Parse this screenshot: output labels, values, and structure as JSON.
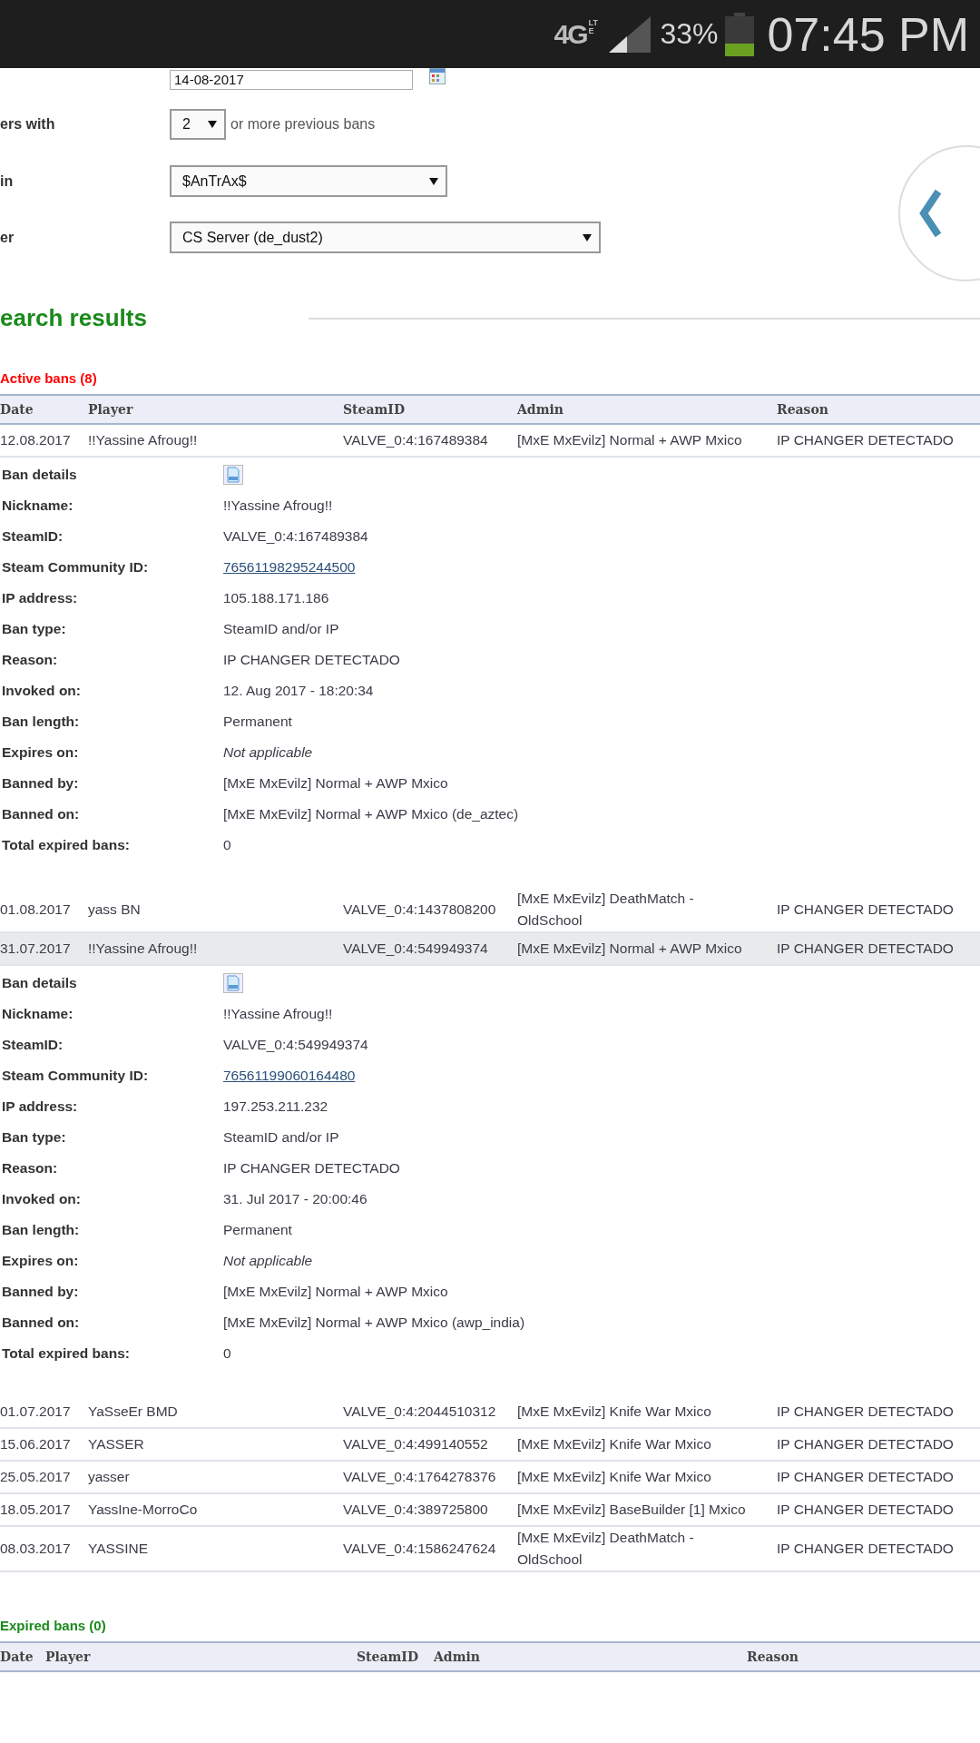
{
  "status_bar": {
    "network": "4G",
    "network_sub": "LTE",
    "battery": "33%",
    "time": "07:45 PM"
  },
  "filters": [
    {
      "kind": "date",
      "value": "14-08-2017"
    },
    {
      "kind": "count",
      "label": "ers with",
      "value": "2",
      "suffix": "or more previous bans"
    },
    {
      "kind": "select",
      "label": "in",
      "value": "$AnTrAx$"
    },
    {
      "kind": "wide-select",
      "label": "er",
      "value": "CS Server (de_dust2)"
    }
  ],
  "heading": "earch results",
  "active_bans": {
    "title": "Active bans (8)",
    "columns": [
      "Date",
      "Player",
      "SteamID",
      "Admin",
      "Reason"
    ],
    "rows": [
      {
        "date": "12.08.2017",
        "player": "!!Yassine Afroug!!",
        "steamid": "VALVE_0:4:167489384",
        "admin": "[MxE MxEvilz] Normal + AWP Mxico",
        "reason": "IP CHANGER DETECTADO",
        "selected": false,
        "details": [
          {
            "kind": "header",
            "label": "Ban details"
          },
          {
            "kind": "text",
            "label": "Nickname:",
            "value": "!!Yassine Afroug!!"
          },
          {
            "kind": "text",
            "label": "SteamID:",
            "value": "VALVE_0:4:167489384"
          },
          {
            "kind": "link",
            "label": "Steam Community ID:",
            "value": "76561198295244500"
          },
          {
            "kind": "text",
            "label": "IP address:",
            "value": "105.188.171.186"
          },
          {
            "kind": "text",
            "label": "Ban type:",
            "value": "SteamID and/or IP"
          },
          {
            "kind": "text",
            "label": "Reason:",
            "value": "IP CHANGER DETECTADO"
          },
          {
            "kind": "text",
            "label": "Invoked on:",
            "value": "12. Aug 2017 - 18:20:34"
          },
          {
            "kind": "text",
            "label": "Ban length:",
            "value": "Permanent"
          },
          {
            "kind": "note",
            "label": "Expires on:",
            "value": "Not applicable"
          },
          {
            "kind": "text",
            "label": "Banned by:",
            "value": "[MxE MxEvilz] Normal + AWP Mxico"
          },
          {
            "kind": "text",
            "label": "Banned on:",
            "value": "[MxE MxEvilz] Normal + AWP Mxico (de_aztec)"
          },
          {
            "kind": "text",
            "label": "Total expired bans:",
            "value": "0"
          }
        ]
      },
      {
        "date": "01.08.2017",
        "player": "yass BN",
        "steamid": "VALVE_0:4:1437808200",
        "admin": "[MxE MxEvilz] DeathMatch - OldSchool",
        "reason": "IP CHANGER DETECTADO",
        "selected": false
      },
      {
        "date": "31.07.2017",
        "player": "!!Yassine Afroug!!",
        "steamid": "VALVE_0:4:549949374",
        "admin": "[MxE MxEvilz] Normal + AWP Mxico",
        "reason": "IP CHANGER DETECTADO",
        "selected": true,
        "details": [
          {
            "kind": "header",
            "label": "Ban details"
          },
          {
            "kind": "text",
            "label": "Nickname:",
            "value": "!!Yassine Afroug!!"
          },
          {
            "kind": "text",
            "label": "SteamID:",
            "value": "VALVE_0:4:549949374"
          },
          {
            "kind": "link",
            "label": "Steam Community ID:",
            "value": "76561199060164480"
          },
          {
            "kind": "text",
            "label": "IP address:",
            "value": "197.253.211.232"
          },
          {
            "kind": "text",
            "label": "Ban type:",
            "value": "SteamID and/or IP"
          },
          {
            "kind": "text",
            "label": "Reason:",
            "value": "IP CHANGER DETECTADO"
          },
          {
            "kind": "text",
            "label": "Invoked on:",
            "value": "31. Jul 2017 - 20:00:46"
          },
          {
            "kind": "text",
            "label": "Ban length:",
            "value": "Permanent"
          },
          {
            "kind": "note",
            "label": "Expires on:",
            "value": "Not applicable"
          },
          {
            "kind": "text",
            "label": "Banned by:",
            "value": "[MxE MxEvilz] Normal + AWP Mxico"
          },
          {
            "kind": "text",
            "label": "Banned on:",
            "value": "[MxE MxEvilz] Normal + AWP Mxico (awp_india)"
          },
          {
            "kind": "text",
            "label": "Total expired bans:",
            "value": "0"
          }
        ]
      },
      {
        "date": "01.07.2017",
        "player": "YaSseEr BMD",
        "steamid": "VALVE_0:4:2044510312",
        "admin": "[MxE MxEvilz] Knife War Mxico",
        "reason": "IP CHANGER DETECTADO",
        "selected": false
      },
      {
        "date": "15.06.2017",
        "player": "YASSER",
        "steamid": "VALVE_0:4:499140552",
        "admin": "[MxE MxEvilz] Knife War Mxico",
        "reason": "IP CHANGER DETECTADO",
        "selected": false
      },
      {
        "date": "25.05.2017",
        "player": "yasser",
        "steamid": "VALVE_0:4:1764278376",
        "admin": "[MxE MxEvilz] Knife War Mxico",
        "reason": "IP CHANGER DETECTADO",
        "selected": false
      },
      {
        "date": "18.05.2017",
        "player": "YassIne-MorroCo",
        "steamid": "VALVE_0:4:389725800",
        "admin": "[MxE MxEvilz] BaseBuilder [1] Mxico",
        "reason": "IP CHANGER DETECTADO",
        "selected": false
      },
      {
        "date": "08.03.2017",
        "player": "YASSINE",
        "steamid": "VALVE_0:4:1586247624",
        "admin": "[MxE MxEvilz] DeathMatch - OldSchool",
        "reason": "IP CHANGER DETECTADO",
        "selected": false
      }
    ]
  },
  "expired_bans": {
    "title": "Expired bans (0)",
    "columns": [
      "Date",
      "Player",
      "SteamID",
      "Admin",
      "Reason"
    ]
  }
}
